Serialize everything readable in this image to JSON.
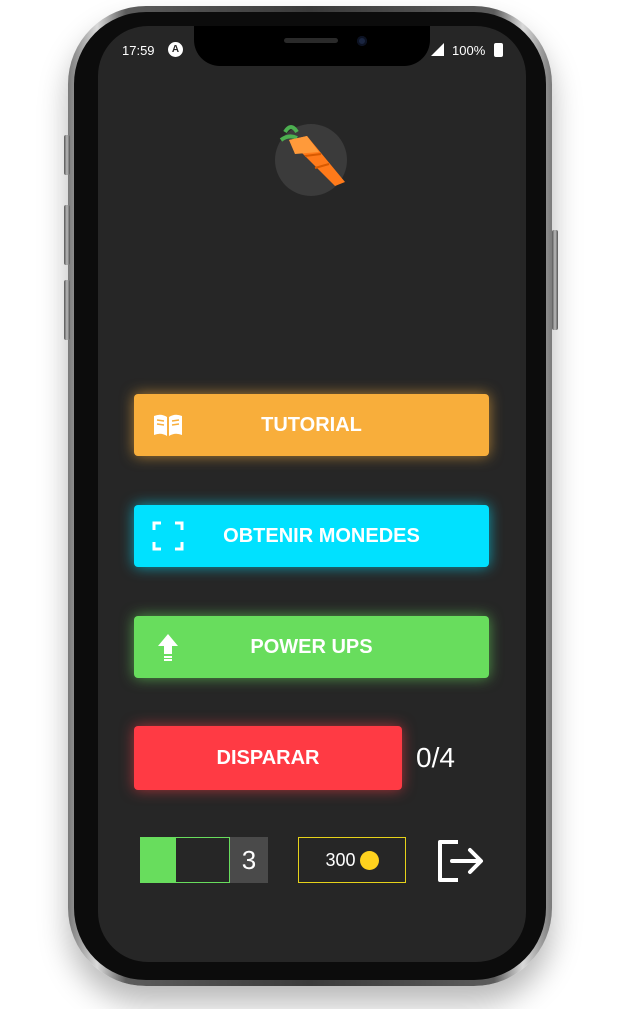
{
  "status_bar": {
    "time": "17:59",
    "app_icon": "A",
    "battery": "100%"
  },
  "logo": {
    "icon": "carrot-icon"
  },
  "menu": {
    "tutorial": {
      "label": "TUTORIAL",
      "icon": "book-icon",
      "color": "#f8ae3b"
    },
    "coins": {
      "label": "OBTENIR MONEDES",
      "icon": "scan-frame-icon",
      "color": "#00e1ff"
    },
    "power_ups": {
      "label": "POWER UPS",
      "icon": "arrow-up-icon",
      "color": "#68dd5d"
    },
    "fire": {
      "label": "DISPARAR",
      "color": "#ff3a44",
      "count": "0/4"
    }
  },
  "bottom_bar": {
    "energy_fraction": 0.4,
    "energy_count": "3",
    "coins": "300",
    "logout_icon": "logout-icon"
  }
}
